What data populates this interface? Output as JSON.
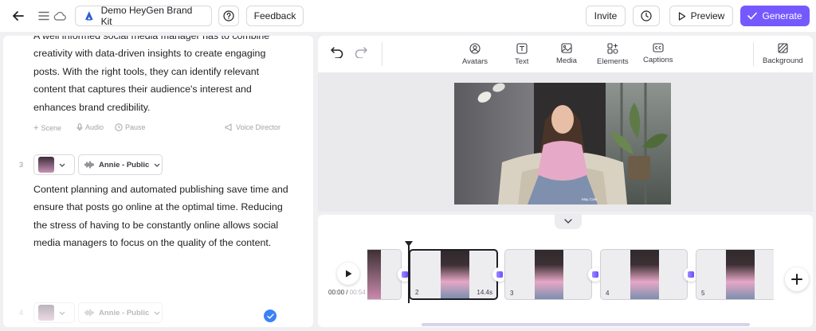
{
  "header": {
    "kit_label": "Demo HeyGen Brand Kit",
    "feedback_label": "Feedback",
    "invite_label": "Invite",
    "preview_label": "Preview",
    "generate_label": "Generate"
  },
  "script": {
    "paragraph1": "A well informed social media manager has to combine creativity with data-driven insights to create engaging posts. With the right tools, they can identify relevant content that captures their audience's interest and enhances brand credibility.",
    "tools": {
      "scene": "Scene",
      "audio": "Audio",
      "pause": "Pause",
      "voice_director": "Voice Director"
    },
    "scenes": [
      {
        "number": "3",
        "voice": "Annie - Public"
      },
      {
        "number": "4",
        "voice": "Annie - Public"
      }
    ],
    "paragraph2": "Content planning and automated publishing save time and ensure that posts go online at the optimal time. Reducing the stress of having to be constantly online allows social media managers to focus on the quality of the content."
  },
  "toolbar": {
    "items": [
      {
        "label": "Avatars",
        "icon": "avatar-icon"
      },
      {
        "label": "Text",
        "icon": "text-icon"
      },
      {
        "label": "Media",
        "icon": "image-icon"
      },
      {
        "label": "Elements",
        "icon": "elements-icon"
      },
      {
        "label": "Captions",
        "icon": "captions-icon"
      }
    ],
    "background_label": "Background"
  },
  "canvas": {
    "watermark": "May Cole"
  },
  "timeline": {
    "current_time": "00:00",
    "separator": " / ",
    "total_time": "00:54",
    "clips": [
      {
        "number": "",
        "duration": ""
      },
      {
        "number": "2",
        "duration": "14.4s"
      },
      {
        "number": "3",
        "duration": ""
      },
      {
        "number": "4",
        "duration": ""
      },
      {
        "number": "5",
        "duration": ""
      }
    ]
  },
  "colors": {
    "accent": "#7559ff",
    "check": "#3b82f6"
  }
}
